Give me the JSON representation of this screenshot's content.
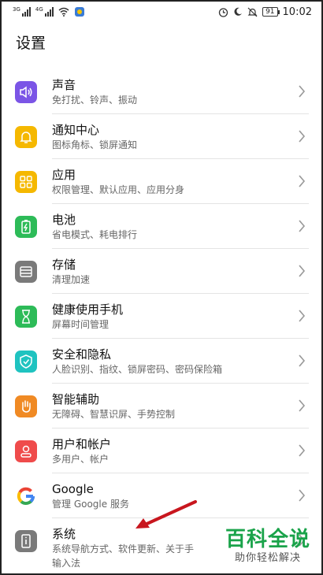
{
  "statusbar": {
    "signal1_label": "3G",
    "signal2_label": "4G",
    "battery": "91",
    "time": "10:02"
  },
  "header": {
    "title": "设置"
  },
  "items": [
    {
      "title": "声音",
      "subtitle": "免打扰、铃声、振动",
      "color": "#7b55e6",
      "icon": "sound-icon"
    },
    {
      "title": "通知中心",
      "subtitle": "图标角标、锁屏通知",
      "color": "#f5b800",
      "icon": "bell-icon"
    },
    {
      "title": "应用",
      "subtitle": "权限管理、默认应用、应用分身",
      "color": "#f5b800",
      "icon": "apps-icon"
    },
    {
      "title": "电池",
      "subtitle": "省电模式、耗电排行",
      "color": "#2dbb58",
      "icon": "battery-icon"
    },
    {
      "title": "存储",
      "subtitle": "清理加速",
      "color": "#7a7a7a",
      "icon": "storage-icon"
    },
    {
      "title": "健康使用手机",
      "subtitle": "屏幕时间管理",
      "color": "#2dbb58",
      "icon": "hourglass-icon"
    },
    {
      "title": "安全和隐私",
      "subtitle": "人脸识别、指纹、锁屏密码、密码保险箱",
      "color": "#1fc3c0",
      "icon": "shield-icon"
    },
    {
      "title": "智能辅助",
      "subtitle": "无障碍、智慧识屏、手势控制",
      "color": "#f08a24",
      "icon": "hand-icon"
    },
    {
      "title": "用户和帐户",
      "subtitle": "多用户、帐户",
      "color": "#ef4b4b",
      "icon": "user-icon"
    },
    {
      "title": "Google",
      "subtitle": "管理 Google 服务",
      "color": "#ffffff",
      "icon": "google-icon"
    },
    {
      "title": "系统",
      "subtitle": "系统导航方式、软件更新、关于手",
      "subtitle2": "输入法",
      "color": "#7a7a7a",
      "icon": "phone-info-icon"
    }
  ],
  "watermark": {
    "title": "百科全说",
    "subtitle": "助你轻松解决"
  }
}
